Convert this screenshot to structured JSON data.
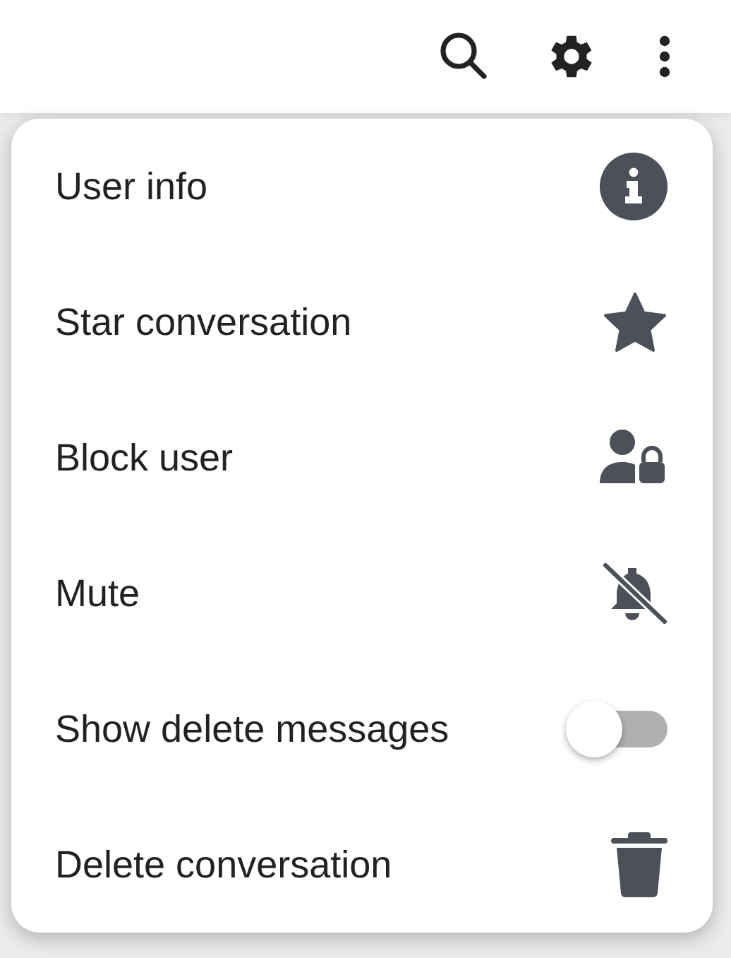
{
  "menu": {
    "items": [
      {
        "kind": "info",
        "label": "User info"
      },
      {
        "kind": "star",
        "label": "Star conversation"
      },
      {
        "kind": "block",
        "label": "Block user"
      },
      {
        "kind": "mute",
        "label": "Mute"
      },
      {
        "kind": "toggle",
        "label": "Show delete messages",
        "on": false
      },
      {
        "kind": "delete",
        "label": "Delete conversation"
      }
    ]
  }
}
